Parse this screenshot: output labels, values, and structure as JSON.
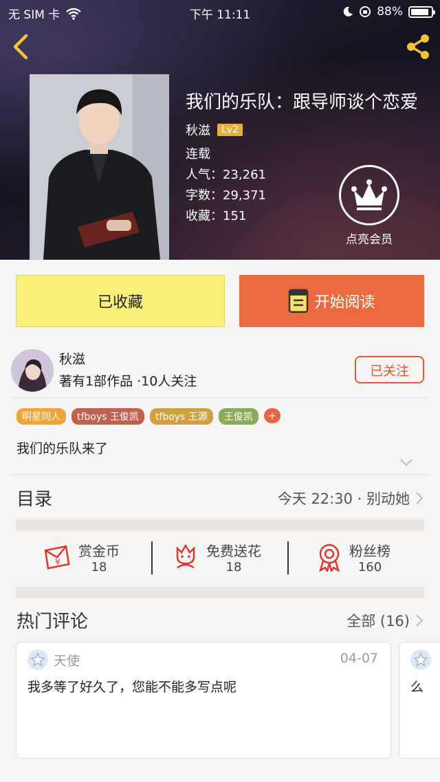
{
  "status_bar": {
    "carrier": "无 SIM 卡",
    "time": "下午 11:11",
    "battery": "88%",
    "battery_level": 0.88
  },
  "book": {
    "title": "我们的乐队：跟导师谈个恋爱",
    "author": "秋滋",
    "level": "Lv2",
    "status": "连载",
    "popularity": "人气：23,261",
    "word_count": "字数：29,371",
    "favorites": "收藏：151",
    "vip_label": "点亮会员",
    "intro": "我们的乐队来了"
  },
  "actions": {
    "favorited_label": "已收藏",
    "read_label": "开始阅读"
  },
  "author_card": {
    "name": "秋滋",
    "info": "著有1部作品 ·10人关注",
    "follow_label": "已关注"
  },
  "tags": [
    {
      "label": "明星同人",
      "color": "#f0a53a"
    },
    {
      "label": "tfboys 王俊凯",
      "color": "#c0614c"
    },
    {
      "label": "tfboys 王源",
      "color": "#d2a040"
    },
    {
      "label": "王俊凯",
      "color": "#8aab57"
    }
  ],
  "tag_more": "+",
  "catalog": {
    "label": "目录",
    "latest": "今天 22:30 · 别动她"
  },
  "stats": [
    {
      "label": "赏金币",
      "value": "18",
      "icon": "red-envelope-icon"
    },
    {
      "label": "免费送花",
      "value": "18",
      "icon": "flower-icon"
    },
    {
      "label": "粉丝榜",
      "value": "160",
      "icon": "medal-icon"
    }
  ],
  "comments": {
    "title": "热门评论",
    "all_label": "全部 (16)",
    "items": [
      {
        "user": "天使",
        "date": "04-07",
        "text": "我多等了好久了，您能不能多写点呢"
      },
      {
        "user": "",
        "date": "",
        "text": "么"
      }
    ]
  },
  "colors": {
    "accent": "#ec6a3f",
    "favorite": "#f9f07a",
    "level": "#e9b13a"
  }
}
